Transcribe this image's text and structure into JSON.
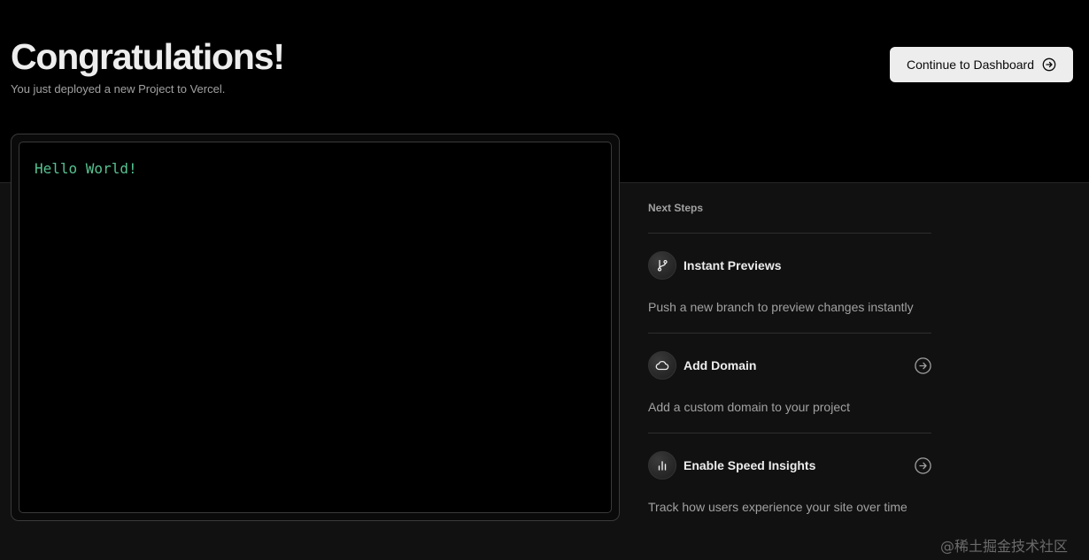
{
  "header": {
    "title": "Congratulations!",
    "subtitle": "You just deployed a new Project to Vercel."
  },
  "actions": {
    "dashboard_label": "Continue to Dashboard",
    "dashboard_icon": "arrow-right-circle-icon"
  },
  "preview": {
    "text": "Hello World!",
    "text_color": "#57c291"
  },
  "next_steps": {
    "heading": "Next Steps",
    "items": [
      {
        "icon": "git-branch-icon",
        "title": "Instant Previews",
        "description": "Push a new branch to preview changes instantly",
        "has_arrow": false
      },
      {
        "icon": "cloud-icon",
        "title": "Add Domain",
        "description": "Add a custom domain to your project",
        "has_arrow": true
      },
      {
        "icon": "bar-chart-icon",
        "title": "Enable Speed Insights",
        "description": "Track how users experience your site over time",
        "has_arrow": true
      }
    ]
  },
  "watermark": "@稀土掘金技术社区",
  "colors": {
    "background": "#000000",
    "panel": "#111111",
    "button_bg": "#ededed"
  }
}
